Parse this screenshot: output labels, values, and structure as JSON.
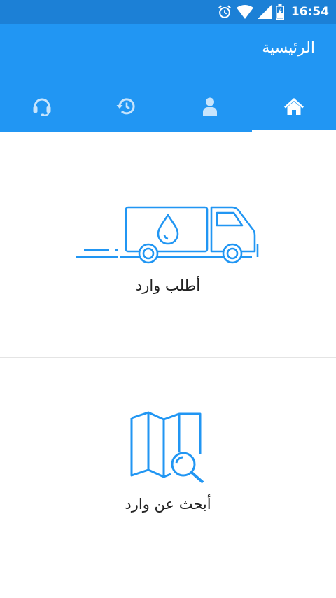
{
  "status_bar": {
    "time": "16:54",
    "icons": [
      "alarm-icon",
      "wifi-icon",
      "signal-icon",
      "battery-icon"
    ]
  },
  "app_bar": {
    "title": "الرئيسية"
  },
  "tabs": [
    {
      "icon": "headset-icon",
      "active": false
    },
    {
      "icon": "history-icon",
      "active": false
    },
    {
      "icon": "person-icon",
      "active": false
    },
    {
      "icon": "home-icon",
      "active": true
    }
  ],
  "cards": [
    {
      "label": "أطلب وارد",
      "icon": "water-truck-icon"
    },
    {
      "label": "أبحث عن وارد",
      "icon": "map-search-icon"
    }
  ],
  "colors": {
    "status_bar": "#1c80d6",
    "app_bar": "#2196f3",
    "icon_blue": "#2196f3"
  }
}
